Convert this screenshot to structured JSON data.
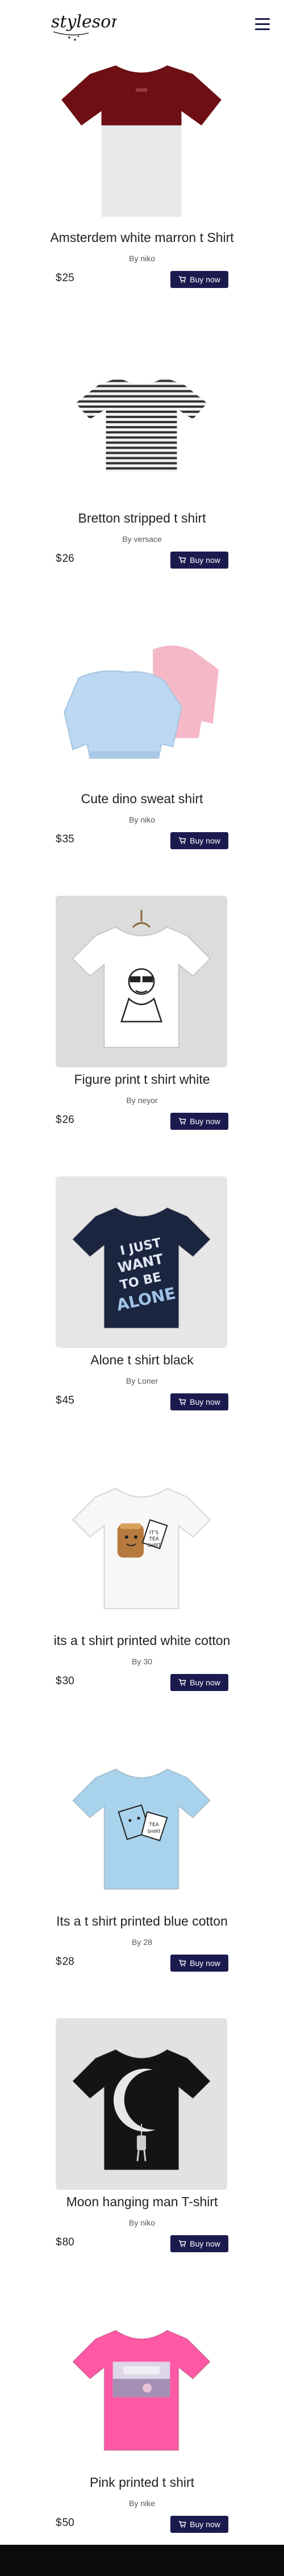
{
  "brand": {
    "logo_text": "stylesore",
    "hamburger_icon": "menu-icon"
  },
  "currency": "$",
  "buy_label": "Buy now",
  "by_prefix": "By",
  "products": [
    {
      "title": "Amsterdem white marron t Shirt",
      "by": "niko",
      "price": "25",
      "image": "maroon-white-tshirt"
    },
    {
      "title": "Bretton stripped t shirt",
      "by": "versace",
      "price": "26",
      "image": "striped-tshirt"
    },
    {
      "title": "Cute dino sweat shirt",
      "by": "niko",
      "price": "35",
      "image": "blue-pink-sweatshirts"
    },
    {
      "title": "Figure print t shirt white",
      "by": "neyor",
      "price": "26",
      "image": "white-figure-tshirt"
    },
    {
      "title": "Alone t shirt black",
      "by": "Loner",
      "price": "45",
      "image": "navy-alone-tshirt"
    },
    {
      "title": "its a t shirt printed white cotton",
      "by": "30",
      "price": "30",
      "image": "white-tea-tshirt"
    },
    {
      "title": "Its a t shirt printed blue cotton",
      "by": "28",
      "price": "28",
      "image": "blue-tea-tshirt"
    },
    {
      "title": "Moon hanging man T-shirt",
      "by": "niko",
      "price": "80",
      "image": "black-moon-tshirt"
    },
    {
      "title": "Pink printed t shirt",
      "by": "nike",
      "price": "50",
      "image": "pink-printed-tshirt"
    }
  ],
  "colors": {
    "accent": "#1b1a4f",
    "footer": "#0b0b0b"
  }
}
